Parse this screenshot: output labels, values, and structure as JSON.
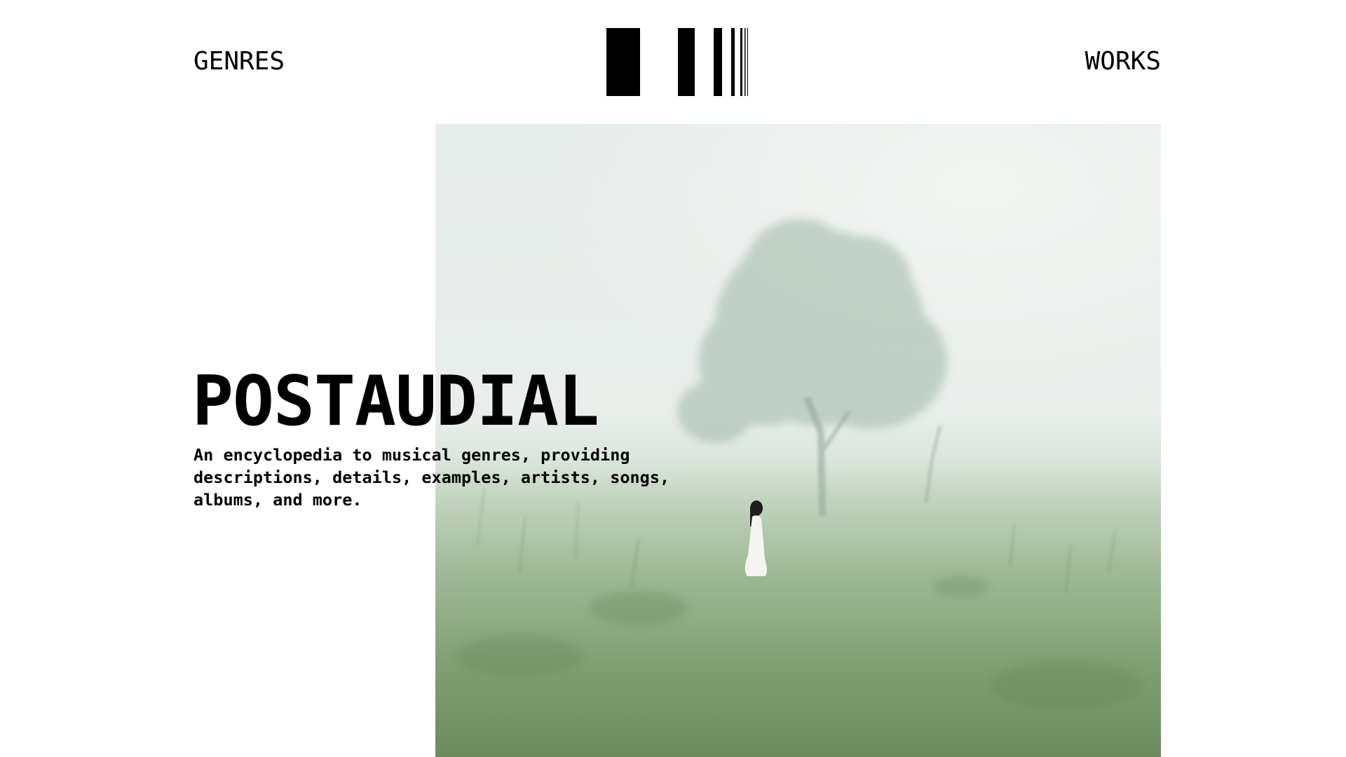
{
  "nav": {
    "genres_label": "GENRES",
    "works_label": "WORKS"
  },
  "logo": {
    "icon": "barcode-logo-icon",
    "color": "#000000"
  },
  "hero": {
    "title": "POSTAUDIAL",
    "description": "An encyclopedia to musical genres, providing descriptions, details, examples, artists, songs, albums, and more.",
    "image": "misty-meadow-photo"
  },
  "colors": {
    "background": "#ffffff",
    "text": "#000000",
    "fog": "#e7ece9",
    "grass": "#6f8f63"
  }
}
